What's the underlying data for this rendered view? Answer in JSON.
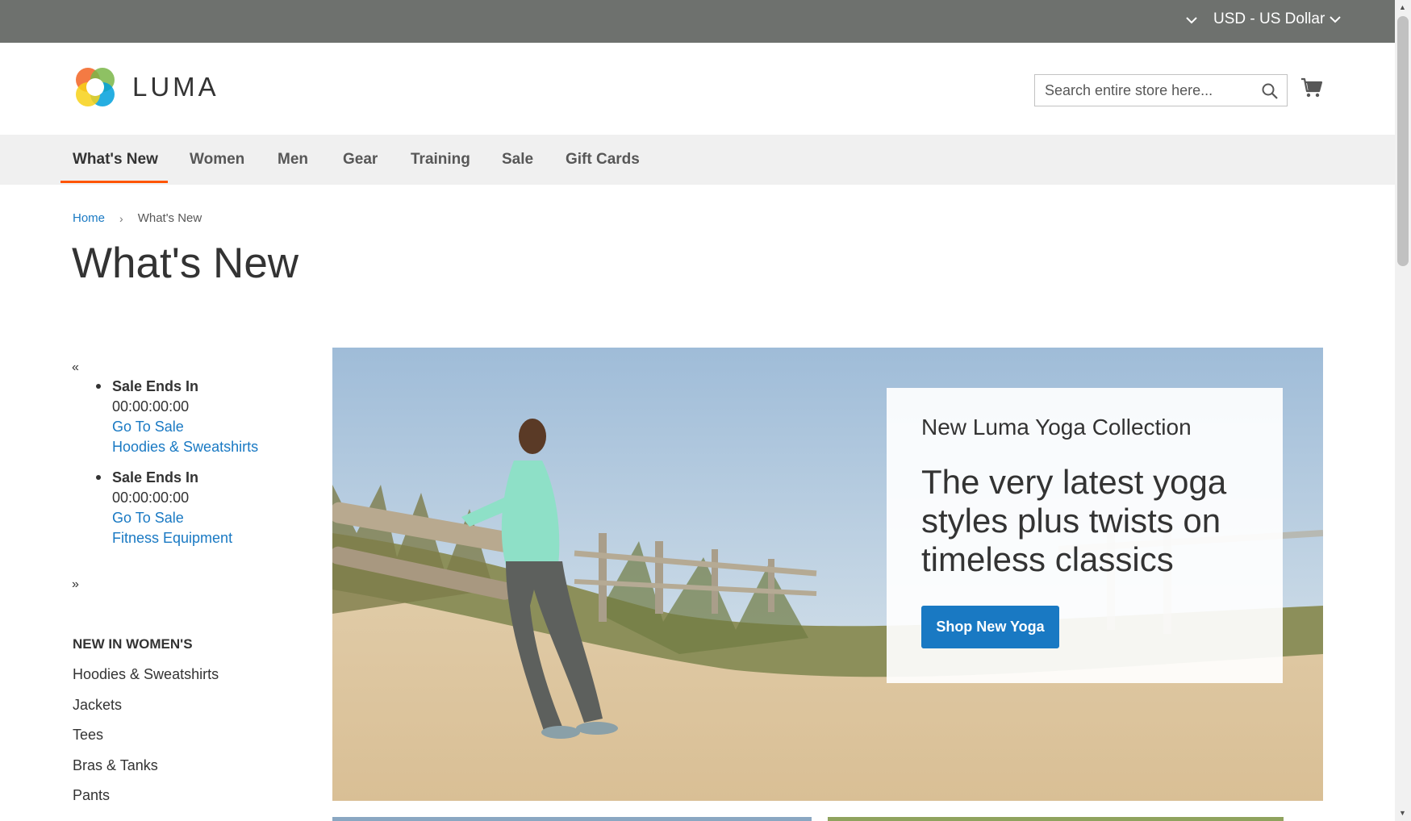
{
  "top_panel": {
    "currency_label": "USD - US Dollar"
  },
  "header": {
    "logo_text": "LUMA",
    "search_placeholder": "Search entire store here..."
  },
  "nav": {
    "items": [
      {
        "label": "What's New",
        "active": true
      },
      {
        "label": "Women"
      },
      {
        "label": "Men"
      },
      {
        "label": "Gear"
      },
      {
        "label": "Training"
      },
      {
        "label": "Sale"
      },
      {
        "label": "Gift Cards"
      }
    ]
  },
  "breadcrumb": {
    "home": "Home",
    "separator": "›",
    "current": "What's New"
  },
  "page_title": "What's New",
  "sidebar": {
    "prev": "«",
    "next": "»",
    "sales": [
      {
        "title": "Sale Ends In",
        "timer": "00:00:00:00",
        "link": "Go To Sale",
        "category": "Hoodies & Sweatshirts"
      },
      {
        "title": "Sale Ends In",
        "timer": "00:00:00:00",
        "link": "Go To Sale",
        "category": "Fitness Equipment"
      }
    ],
    "new_in_title": "NEW IN WOMEN'S",
    "new_in_items": [
      "Hoodies & Sweatshirts",
      "Jackets",
      "Tees",
      "Bras & Tanks",
      "Pants"
    ]
  },
  "hero": {
    "subtitle": "New Luma Yoga Collection",
    "headline": "The very latest yoga styles plus twists on timeless classics",
    "button_label": "Shop New Yoga"
  },
  "colors": {
    "top_panel": "#6e716e",
    "nav_bg": "#f0f0f0",
    "active_underline": "#ff5501",
    "link": "#1979c3",
    "button": "#1979c3"
  }
}
